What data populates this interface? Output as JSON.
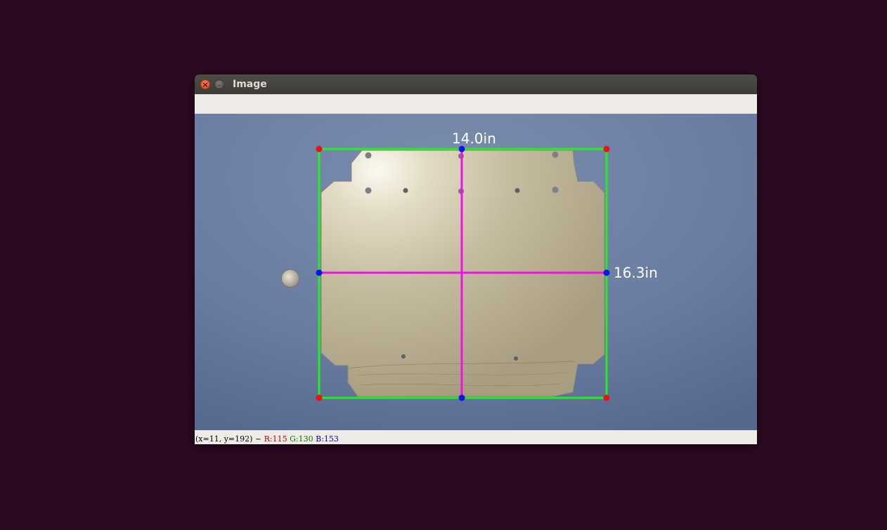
{
  "window": {
    "title": "Image",
    "close_glyph": "×",
    "minimize_glyph": "–"
  },
  "image": {
    "width_label": "14.0in",
    "height_label": "16.3in",
    "colors": {
      "background": "#6b7ea3",
      "plate": "#c9c0a6",
      "bounding_box": "#22ee22",
      "midlines": "#ee11ee",
      "corner_points": "#ee1111",
      "midpoints": "#1111ee",
      "label_text": "#ffffff"
    }
  },
  "status": {
    "coords": "(x=11, y=192) ~ ",
    "r": "R:115",
    "g": "G:130",
    "b": "B:153"
  }
}
